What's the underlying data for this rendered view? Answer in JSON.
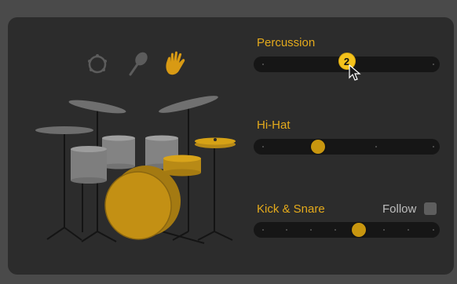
{
  "instrument_picker": {
    "icons": [
      "tambourine-icon",
      "shaker-icon",
      "hand-clap-icon"
    ],
    "selected": "hand-clap-icon"
  },
  "controls": {
    "percussion": {
      "label": "Percussion",
      "value_fraction": 0.5,
      "badge": "2",
      "ticks": 2
    },
    "hihat": {
      "label": "Hi-Hat",
      "value_fraction": 0.33,
      "ticks": 4
    },
    "kick_snare": {
      "label": "Kick & Snare",
      "value_fraction": 0.57,
      "ticks": 8
    },
    "follow": {
      "label": "Follow",
      "checked": false
    }
  },
  "colors": {
    "accent": "#e4aa1c",
    "knob": "#c8960f",
    "panel": "#2c2c2c",
    "track": "#161616",
    "inactive_drum": "#8a8a8a"
  }
}
